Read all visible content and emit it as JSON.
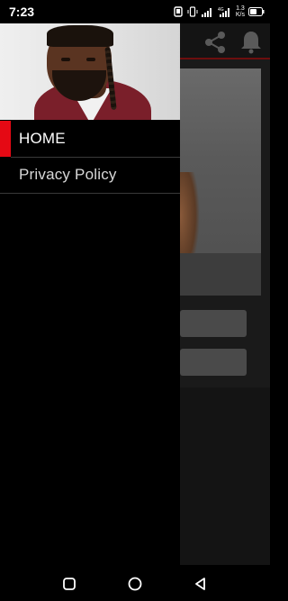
{
  "status_bar": {
    "time": "7:23",
    "network_speed_value": "1.3",
    "network_speed_unit": "K/s",
    "icons": [
      "alarm-icon",
      "vibrate-icon",
      "signal-icon",
      "4g-signal-icon",
      "battery-icon"
    ]
  },
  "drawer": {
    "header_image": "artist-portrait",
    "items": [
      {
        "label": "HOME",
        "active": true
      },
      {
        "label": "Privacy Policy",
        "active": false
      }
    ],
    "accent_color": "#e50914"
  },
  "app_toolbar": {
    "icons": [
      "share-icon",
      "notification-bell-icon"
    ]
  },
  "nav_bar": {
    "buttons": [
      "recent-apps-button",
      "home-button",
      "back-button"
    ]
  }
}
